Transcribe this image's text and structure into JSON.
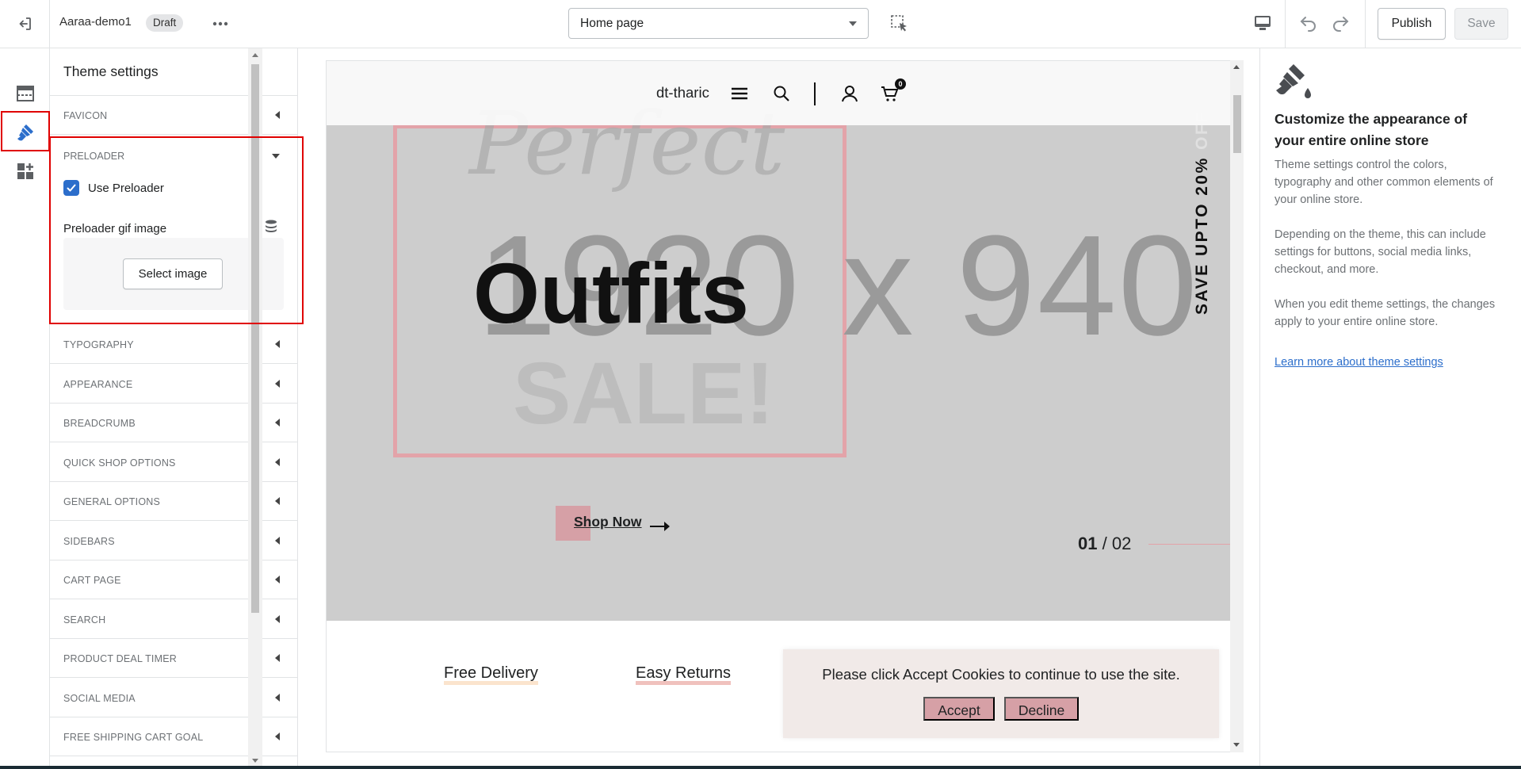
{
  "topbar": {
    "store_name": "Aaraa-demo1",
    "status_badge": "Draft",
    "page_selector": "Home page",
    "publish_label": "Publish",
    "save_label": "Save"
  },
  "sidebar": {
    "title": "Theme settings",
    "sections_top": [
      "FAVICON"
    ],
    "preloader": {
      "label": "PRELOADER",
      "use_preloader_label": "Use Preloader",
      "use_preloader_checked": true,
      "gif_label": "Preloader gif image",
      "select_image_label": "Select image"
    },
    "sections": [
      "TYPOGRAPHY",
      "APPEARANCE",
      "BREADCRUMB",
      "QUICK SHOP OPTIONS",
      "GENERAL OPTIONS",
      "SIDEBARS",
      "CART PAGE",
      "SEARCH",
      "PRODUCT DEAL TIMER",
      "SOCIAL MEDIA",
      "FREE SHIPPING CART GOAL"
    ]
  },
  "preview": {
    "brand": "dt-tharic",
    "cart_count": "0",
    "hero": {
      "script_text": "Perfect",
      "placeholder_size": "1920 x 940",
      "sale_text": "SALE!",
      "heading": "Outfits",
      "cta": "Shop Now",
      "slide_current": "01",
      "slide_total": "/ 02",
      "vertical_text": "SAVE UPTO 20%",
      "vertical_text_faded": "OFF"
    },
    "features": [
      "Free Delivery",
      "Easy Returns"
    ],
    "cookie": {
      "message": "Please click Accept Cookies to continue to use the site.",
      "accept": "Accept",
      "decline": "Decline"
    }
  },
  "right_panel": {
    "title": "Customize the appearance of your entire online store",
    "paragraphs": [
      "Theme settings control the colors, typography and other common elements of your online store.",
      "Depending on the theme, this can include settings for buttons, social media links, checkout, and more.",
      "When you edit theme settings, the changes apply to your entire online store."
    ],
    "link": "Learn more about theme settings"
  },
  "colors": {
    "accent_blue": "#2c6ecb",
    "highlight_red": "#e00000",
    "hero_bg": "#cdcdcd",
    "pink_accent": "#d6a0a6"
  }
}
